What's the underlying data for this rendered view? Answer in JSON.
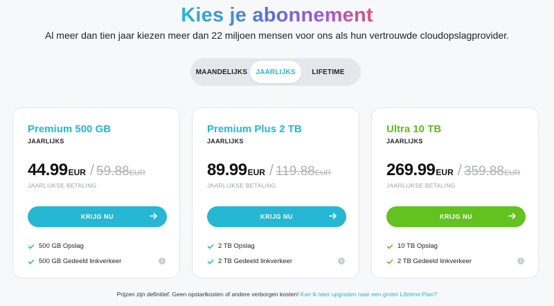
{
  "header": {
    "title": "Kies je abonnement",
    "subtitle": "Al meer dan tien jaar kiezen meer dan 22 miljoen mensen voor ons als hun vertrouwde cloudopslagprovider."
  },
  "billing_toggle": {
    "options": [
      "MAANDELIJKS",
      "JAARLIJKS",
      "LIFETIME"
    ],
    "selected": "JAARLIJKS"
  },
  "plans": [
    {
      "name": "Premium 500 GB",
      "period": "JAARLIJKS",
      "price": "44.99",
      "currency": "EUR",
      "old_price": "59.88",
      "old_currency": "EUR",
      "billing_note": "JAARLIJKSE BETALING",
      "cta": "KRIJG NU",
      "features": [
        "500 GB Opslag",
        "500 GB Gedeeld linkverkeer"
      ],
      "accent": "#25b7d3"
    },
    {
      "name": "Premium Plus 2 TB",
      "period": "JAARLIJKS",
      "price": "89.99",
      "currency": "EUR",
      "old_price": "119.88",
      "old_currency": "EUR",
      "billing_note": "JAARLIJKSE BETALING",
      "cta": "KRIJG NU",
      "features": [
        "2 TB Opslag",
        "2 TB Gedeeld linkverkeer"
      ],
      "accent": "#25b7d3"
    },
    {
      "name": "Ultra 10 TB",
      "period": "JAARLIJKS",
      "price": "269.99",
      "currency": "EUR",
      "old_price": "359.88",
      "old_currency": "EUR",
      "billing_note": "JAARLIJKSE BETALING",
      "cta": "KRIJG NU",
      "features": [
        "10 TB Opslag",
        "2 TB Gedeeld linkverkeer"
      ],
      "accent": "#62c21e"
    }
  ],
  "footer": {
    "text": "Prijzen zijn definitief. Geen opstartkosten of andere verborgen kosten!",
    "link": "Kan ik later upgraden naar een groter Lifetime Plan?"
  },
  "icons": {
    "check": "check-icon",
    "arrow": "arrow-right-icon",
    "info": "info-icon"
  }
}
